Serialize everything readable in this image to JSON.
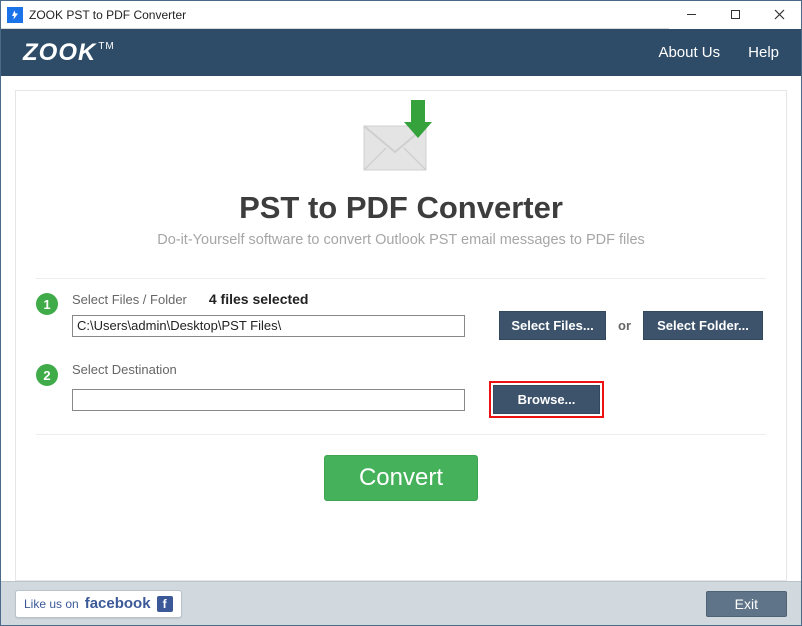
{
  "window": {
    "title": "ZOOK PST to PDF Converter"
  },
  "header": {
    "logo_text": "ZOOK",
    "logo_tm": "TM",
    "links": {
      "about": "About Us",
      "help": "Help"
    }
  },
  "hero": {
    "title": "PST to PDF Converter",
    "subtitle": "Do-it-Yourself software to convert Outlook PST email messages to PDF files"
  },
  "step1": {
    "num": "1",
    "label": "Select Files / Folder",
    "files_selected": "4 files selected",
    "path": "C:\\Users\\admin\\Desktop\\PST Files\\",
    "select_files_btn": "Select Files...",
    "or": "or",
    "select_folder_btn": "Select Folder..."
  },
  "step2": {
    "num": "2",
    "label": "Select Destination",
    "path": "",
    "browse_btn": "Browse..."
  },
  "actions": {
    "convert": "Convert"
  },
  "footer": {
    "fb_prefix": "Like us on",
    "fb_brand": "facebook",
    "fb_glyph": "f",
    "exit": "Exit"
  }
}
